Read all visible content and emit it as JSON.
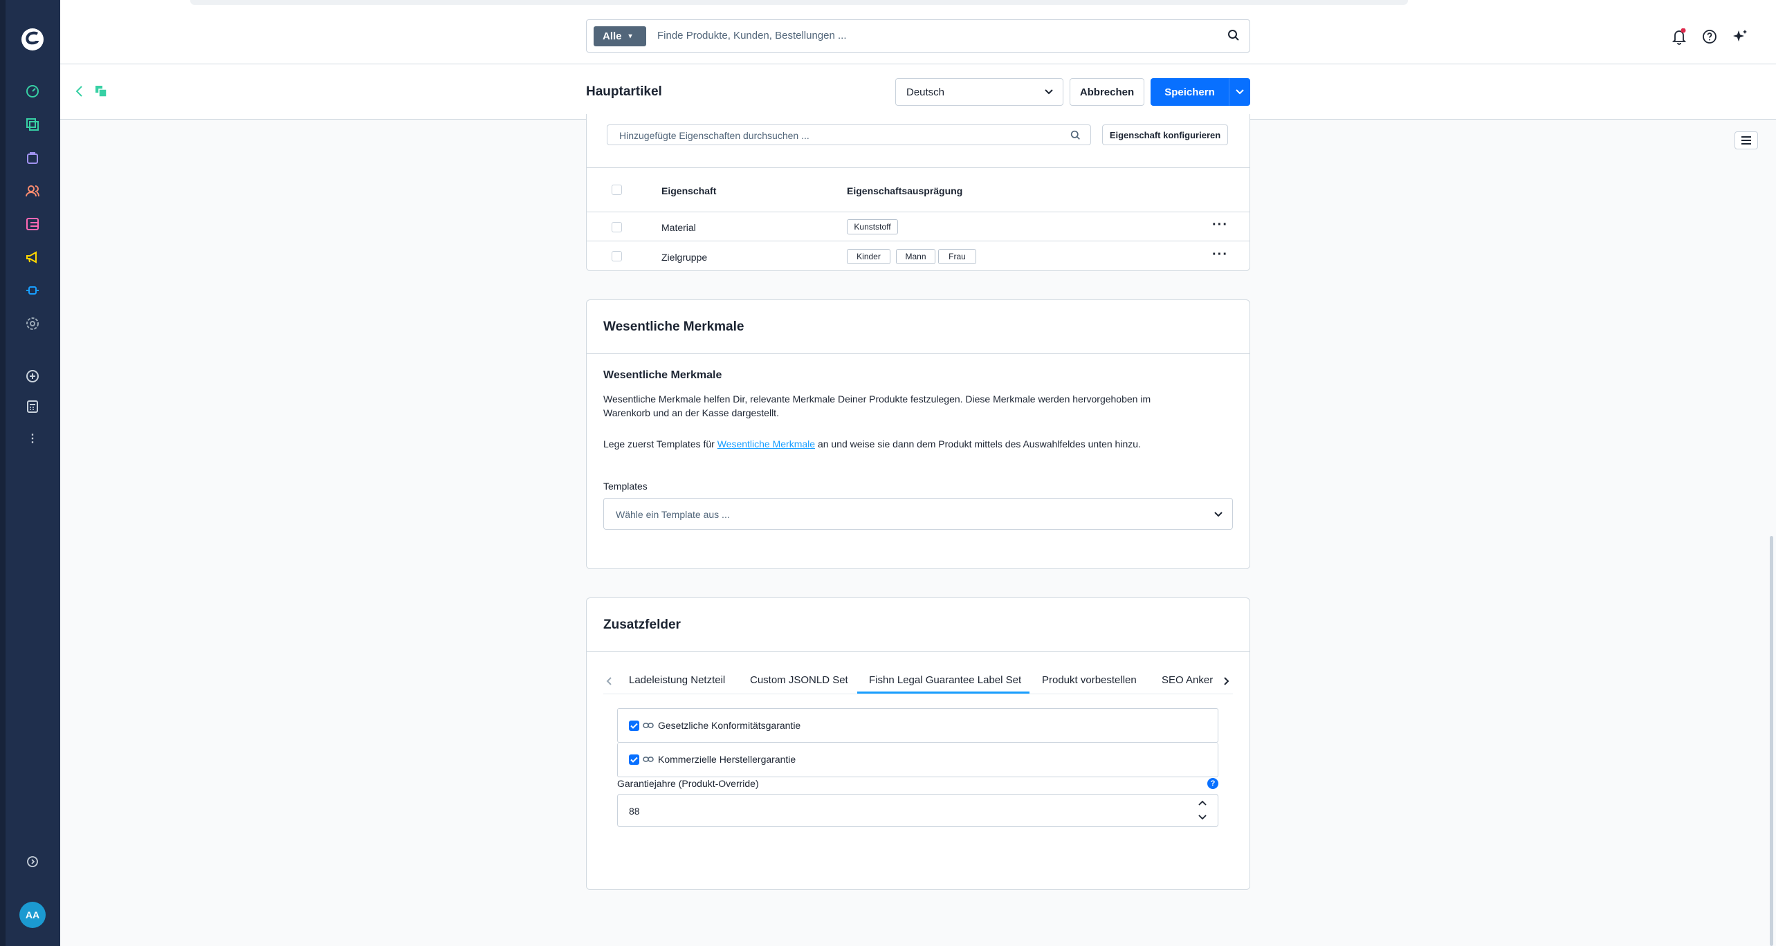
{
  "search": {
    "scope_label": "Alle",
    "placeholder": "Finde Produkte, Kunden, Bestellungen ..."
  },
  "header": {
    "title": "Hauptartikel",
    "language": "Deutsch",
    "cancel_label": "Abbrechen",
    "save_label": "Speichern"
  },
  "properties": {
    "search_placeholder": "Hinzugefügte Eigenschaften durchsuchen ...",
    "configure_label": "Eigenschaft konfigurieren",
    "columns": [
      "Eigenschaft",
      "Eigenschaftsausprägung"
    ],
    "rows": [
      {
        "name": "Material",
        "values": [
          "Kunststoff"
        ]
      },
      {
        "name": "Zielgruppe",
        "values": [
          "Kinder",
          "Mann",
          "Frau"
        ]
      }
    ]
  },
  "features": {
    "card_title": "Wesentliche Merkmale",
    "heading": "Wesentliche Merkmale",
    "description_line1": "Wesentliche Merkmale helfen Dir, relevante Merkmale Deiner Produkte festzulegen. Diese Merkmale werden hervorgehoben im",
    "description_line2": "Warenkorb und an der Kasse dargestellt.",
    "hint_prefix": "Lege zuerst Templates für ",
    "hint_link": "Wesentliche Merkmale",
    "hint_suffix": " an und weise sie dann dem Produkt mittels des Auswahlfeldes unten hinzu.",
    "templates_label": "Templates",
    "templates_placeholder": "Wähle ein Template aus ..."
  },
  "custom_fields": {
    "title": "Zusatzfelder",
    "tabs": [
      "Ladeleistung Netzteil",
      "Custom JSONLD Set",
      "Fishn Legal Guarantee Label Set",
      "Produkt vorbestellen",
      "SEO Anker"
    ],
    "active_tab": "Fishn Legal Guarantee Label Set",
    "checkboxes": [
      {
        "label": "Gesetzliche Konformitätsgarantie",
        "checked": true
      },
      {
        "label": "Kommerzielle Herstellergarantie",
        "checked": true
      }
    ],
    "number_label": "Garantiejahre (Produkt-Override)",
    "number_value": "88"
  },
  "user": {
    "initials": "AA"
  },
  "colors": {
    "sidebar": "#1f2f4d",
    "primary": "#0870ff",
    "text": "#1c2432",
    "border": "#d1d9e0"
  }
}
